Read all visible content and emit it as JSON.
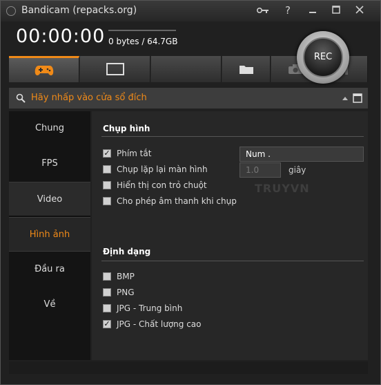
{
  "window": {
    "title": "Bandicam (repacks.org)"
  },
  "titlebar_buttons": [
    "key-icon",
    "help-icon",
    "minimize-icon",
    "restore-icon",
    "close-icon"
  ],
  "help_label": "?",
  "status": {
    "timer": "00:00:00",
    "size": "0 bytes / 64.7GB"
  },
  "rec": {
    "label": "REC"
  },
  "toolbar": {
    "tools": [
      "game-mode-icon",
      "screen-mode-icon",
      "blank",
      "folder-icon",
      "camera-icon",
      "pause-icon"
    ],
    "active": "game-mode-icon"
  },
  "hint": {
    "text": "Hãy nhấp vào cửa sổ đích"
  },
  "sidebar": {
    "items": [
      {
        "label": "Chung"
      },
      {
        "label": "FPS"
      },
      {
        "label": "Video"
      },
      {
        "label": "Hình ảnh"
      },
      {
        "label": "Đầu ra"
      },
      {
        "label": "Về"
      }
    ],
    "active_index": 3
  },
  "capture": {
    "title": "Chụp hình",
    "hotkey": {
      "label": "Phím tắt",
      "checked": true,
      "value": "Num ."
    },
    "repeat": {
      "label": "Chụp lặp lại màn hình",
      "checked": false,
      "value": "1.0",
      "unit": "giây"
    },
    "cursor": {
      "label": "Hiển thị con trỏ chuột",
      "checked": false
    },
    "sound": {
      "label": "Cho phép âm thanh khi chụp",
      "checked": false
    }
  },
  "format": {
    "title": "Định dạng",
    "options": [
      {
        "label": "BMP",
        "checked": false
      },
      {
        "label": "PNG",
        "checked": false
      },
      {
        "label": "JPG - Trung bình",
        "checked": false
      },
      {
        "label": "JPG - Chất lượng cao",
        "checked": true
      }
    ]
  },
  "watermark": "TRUYVN",
  "colors": {
    "accent": "#f08a18",
    "background": "#202020"
  }
}
